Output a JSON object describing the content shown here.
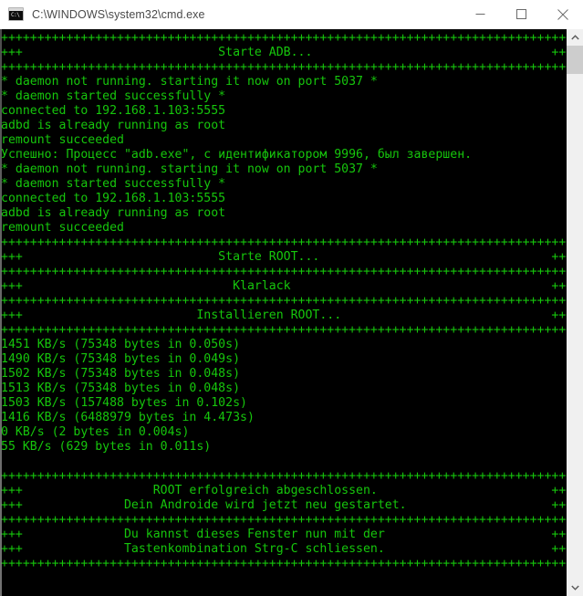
{
  "window": {
    "title": "C:\\WINDOWS\\system32\\cmd.exe",
    "icon_name": "cmd-icon",
    "icon_prompt_text": "C:\\",
    "buttons": {
      "minimize_label": "Minimize",
      "maximize_label": "Maximize",
      "close_label": "Close"
    }
  },
  "console": {
    "foreground_color": "#16c60c",
    "background_color": "#000000",
    "scrollbar": {
      "up_arrow_label": "Scroll up",
      "down_arrow_label": "Scroll down",
      "thumb_label": "Scroll thumb"
    },
    "lines": [
      "++++++++++++++++++++++++++++++++++++++++++++++++++++++++++++++++++++++++++++++++",
      "+++                           Starte ADB...                                 +++",
      "++++++++++++++++++++++++++++++++++++++++++++++++++++++++++++++++++++++++++++++++",
      "* daemon not running. starting it now on port 5037 *",
      "* daemon started successfully *",
      "connected to 192.168.1.103:5555",
      "adbd is already running as root",
      "remount succeeded",
      "Успешно: Процесс \"adb.exe\", с идентификатором 9996, был завершен.",
      "* daemon not running. starting it now on port 5037 *",
      "* daemon started successfully *",
      "connected to 192.168.1.103:5555",
      "adbd is already running as root",
      "remount succeeded",
      "++++++++++++++++++++++++++++++++++++++++++++++++++++++++++++++++++++++++++++++++",
      "+++                           Starte ROOT...                                +++",
      "++++++++++++++++++++++++++++++++++++++++++++++++++++++++++++++++++++++++++++++++",
      "+++                             Klarlack                                    +++",
      "++++++++++++++++++++++++++++++++++++++++++++++++++++++++++++++++++++++++++++++++",
      "+++                        Installieren ROOT...                             +++",
      "++++++++++++++++++++++++++++++++++++++++++++++++++++++++++++++++++++++++++++++++",
      "1451 KB/s (75348 bytes in 0.050s)",
      "1490 KB/s (75348 bytes in 0.049s)",
      "1502 KB/s (75348 bytes in 0.048s)",
      "1513 KB/s (75348 bytes in 0.048s)",
      "1503 KB/s (157488 bytes in 0.102s)",
      "1416 KB/s (6488979 bytes in 4.473s)",
      "0 KB/s (2 bytes in 0.004s)",
      "55 KB/s (629 bytes in 0.011s)",
      "",
      "++++++++++++++++++++++++++++++++++++++++++++++++++++++++++++++++++++++++++++++++",
      "+++                  ROOT erfolgreich abgeschlossen.                        +++",
      "+++              Dein Androide wird jetzt neu gestartet.                    +++",
      "++++++++++++++++++++++++++++++++++++++++++++++++++++++++++++++++++++++++++++++++",
      "+++              Du kannst dieses Fenster nun mit der                       +++",
      "+++              Tastenkombination Strg-C schliessen.                       +++",
      "++++++++++++++++++++++++++++++++++++++++++++++++++++++++++++++++++++++++++++++++"
    ]
  }
}
